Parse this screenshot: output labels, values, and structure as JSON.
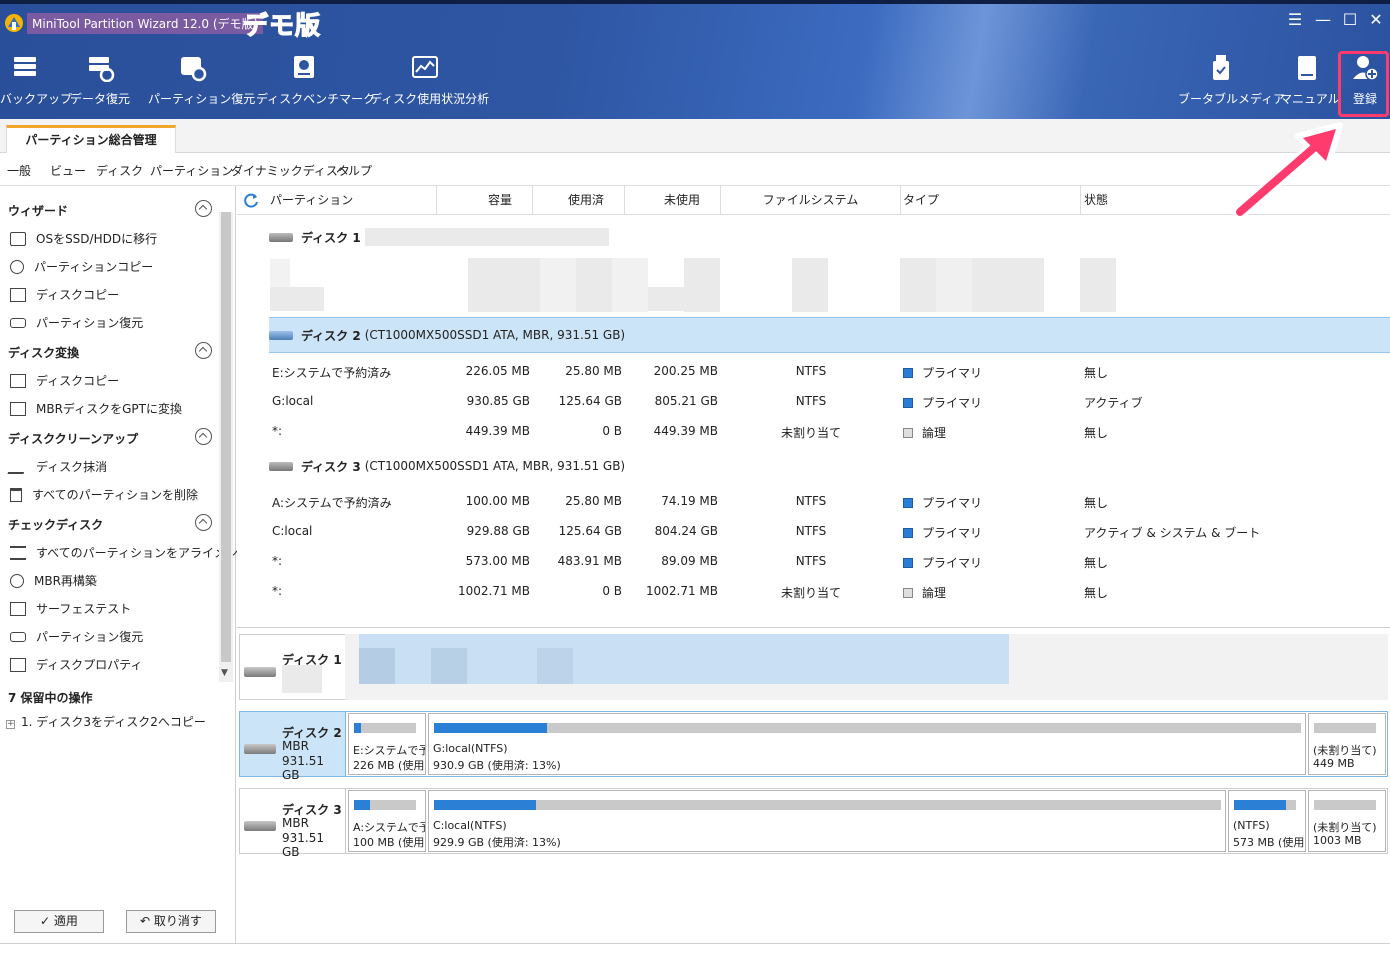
{
  "window": {
    "title": "MiniTool Partition Wizard 12.0 (デモ版)",
    "demo_badge": "デモ版",
    "controls": [
      "☰",
      "—",
      "☐",
      "✕"
    ]
  },
  "toolbar": {
    "left": [
      {
        "label": "バックアップ",
        "icon": "backup-icon"
      },
      {
        "label": "データ復元",
        "icon": "data-recovery-icon"
      },
      {
        "label": "パーティション復元",
        "icon": "partition-recovery-icon"
      },
      {
        "label": "ディスクベンチマーク",
        "icon": "disk-benchmark-icon"
      },
      {
        "label": "ディスク使用状況分析",
        "icon": "space-analyzer-icon"
      }
    ],
    "right": [
      {
        "label": "ブータブルメディア",
        "icon": "bootable-media-icon"
      },
      {
        "label": "マニュアル",
        "icon": "manual-icon"
      },
      {
        "label": "登録",
        "icon": "register-icon"
      }
    ]
  },
  "tabs": {
    "main": "パーティション総合管理"
  },
  "menu": [
    "一般",
    "ビュー",
    "ディスク",
    "パーティション",
    "ダイナミックディスク",
    "ヘルプ"
  ],
  "sidebar": {
    "sections": [
      {
        "title": "ウィザード",
        "items": [
          "OSをSSD/HDDに移行",
          "パーティションコピー",
          "ディスクコピー",
          "パーティション復元"
        ]
      },
      {
        "title": "ディスク変換",
        "items": [
          "ディスクコピー",
          "MBRディスクをGPTに変換"
        ]
      },
      {
        "title": "ディスククリーンアップ",
        "items": [
          "ディスク抹消",
          "すべてのパーティションを削除"
        ]
      },
      {
        "title": "チェックディスク",
        "items": [
          "すべてのパーティションをアライメント",
          "MBR再構築",
          "サーフェステスト",
          "パーティション復元",
          "ディスクプロパティ"
        ]
      }
    ],
    "pending_title": "7 保留中の操作",
    "pending_items": [
      "1. ディスク3をディスク2へコピー"
    ],
    "apply_label": "適用",
    "undo_label": "取り消す"
  },
  "table": {
    "headers": [
      "パーティション",
      "容量",
      "使用済",
      "未使用",
      "ファイルシステム",
      "タイプ",
      "状態"
    ],
    "disk1": {
      "name": "ディスク 1"
    },
    "disk2": {
      "name": "ディスク 2",
      "info": "(CT1000MX500SSD1 ATA, MBR, 931.51 GB)",
      "rows": [
        {
          "part": "E:システムで予約済み",
          "cap": "226.05 MB",
          "used": "25.80 MB",
          "free": "200.25 MB",
          "fs": "NTFS",
          "type": "プライマリ",
          "type_color": "blue",
          "status": "無し"
        },
        {
          "part": "G:local",
          "cap": "930.85 GB",
          "used": "125.64 GB",
          "free": "805.21 GB",
          "fs": "NTFS",
          "type": "プライマリ",
          "type_color": "blue",
          "status": "アクティブ"
        },
        {
          "part": "*:",
          "cap": "449.39 MB",
          "used": "0 B",
          "free": "449.39 MB",
          "fs": "未割り当て",
          "type": "論理",
          "type_color": "gray",
          "status": "無し"
        }
      ]
    },
    "disk3": {
      "name": "ディスク 3",
      "info": "(CT1000MX500SSD1 ATA, MBR, 931.51 GB)",
      "rows": [
        {
          "part": "A:システムで予約済み",
          "cap": "100.00 MB",
          "used": "25.80 MB",
          "free": "74.19 MB",
          "fs": "NTFS",
          "type": "プライマリ",
          "type_color": "blue",
          "status": "無し"
        },
        {
          "part": "C:local",
          "cap": "929.88 GB",
          "used": "125.64 GB",
          "free": "804.24 GB",
          "fs": "NTFS",
          "type": "プライマリ",
          "type_color": "blue",
          "status": "アクティブ & システム & ブート"
        },
        {
          "part": "*:",
          "cap": "573.00 MB",
          "used": "483.91 MB",
          "free": "89.09 MB",
          "fs": "NTFS",
          "type": "プライマリ",
          "type_color": "blue",
          "status": "無し"
        },
        {
          "part": "*:",
          "cap": "1002.71 MB",
          "used": "0 B",
          "free": "1002.71 MB",
          "fs": "未割り当て",
          "type": "論理",
          "type_color": "gray",
          "status": "無し"
        }
      ]
    }
  },
  "diskmap": {
    "disk1": {
      "name": "ディスク 1"
    },
    "disk2": {
      "name": "ディスク 2",
      "type": "MBR",
      "size": "931.51 GB",
      "parts": [
        {
          "l1": "E:システムで予",
          "l2": "226 MB (使用",
          "used_frac": 0.11
        },
        {
          "l1": "G:local(NTFS)",
          "l2": "930.9 GB (使用済: 13%)",
          "used_frac": 0.13
        },
        {
          "l1": "(未割り当て)",
          "l2": "449 MB",
          "used_frac": 0
        }
      ]
    },
    "disk3": {
      "name": "ディスク 3",
      "type": "MBR",
      "size": "931.51 GB",
      "parts": [
        {
          "l1": "A:システムで予",
          "l2": "100 MB (使用",
          "used_frac": 0.26
        },
        {
          "l1": "C:local(NTFS)",
          "l2": "929.9 GB (使用済: 13%)",
          "used_frac": 0.13
        },
        {
          "l1": "(NTFS)",
          "l2": "573 MB (使用",
          "used_frac": 0.84
        },
        {
          "l1": "(未割り当て)",
          "l2": "1003 MB",
          "used_frac": 0
        }
      ]
    }
  },
  "colors": {
    "accent": "#2b80d6",
    "highlight": "#ff3a6d",
    "selected_row": "#cce4f7"
  }
}
